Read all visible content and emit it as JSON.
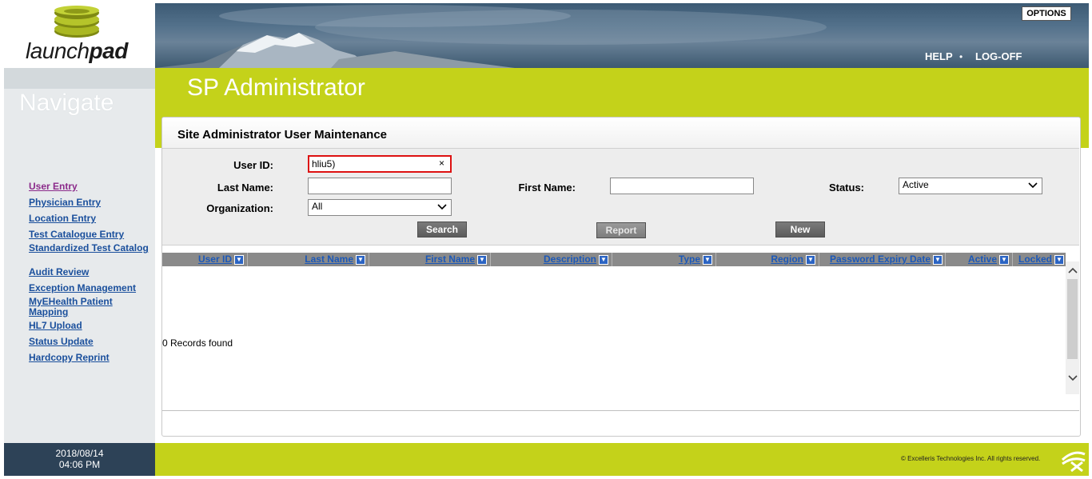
{
  "app": {
    "logo_prefix": "launch",
    "logo_suffix": "pad",
    "page_title": "SP Administrator"
  },
  "header": {
    "options": "OPTIONS",
    "help": "HELP",
    "separator": "•",
    "logoff": "LOG-OFF"
  },
  "sidebar": {
    "heading": "Navigate",
    "items": [
      {
        "label": "User Entry",
        "current": true
      },
      {
        "label": "Physician Entry"
      },
      {
        "label": "Location Entry"
      },
      {
        "label": "Test Catalogue Entry"
      },
      {
        "label": "Standardized Test Catalog"
      },
      {
        "label": "Audit Review"
      },
      {
        "label": "Exception Management"
      },
      {
        "label": "MyEHealth Patient Mapping"
      },
      {
        "label": "HL7 Upload"
      },
      {
        "label": "Status Update"
      },
      {
        "label": "Hardcopy Reprint"
      }
    ]
  },
  "panel": {
    "title": "Site Administrator User Maintenance"
  },
  "form": {
    "user_id_label": "User ID:",
    "user_id_value": "hliu5)",
    "clear_glyph": "×",
    "last_name_label": "Last Name:",
    "last_name_value": "",
    "first_name_label": "First Name:",
    "first_name_value": "",
    "status_label": "Status:",
    "status_value": "Active",
    "organization_label": "Organization:",
    "organization_value": "All",
    "search_button": "Search",
    "report_button": "Report",
    "new_button": "New"
  },
  "table": {
    "columns": [
      "User ID",
      "Last Name",
      "First Name",
      "Description",
      "Type",
      "Region",
      "Password Expiry Date",
      "Active",
      "Locked"
    ],
    "rows": [],
    "records_text": "0 Records found"
  },
  "footer": {
    "date": "2018/08/14",
    "time": "04:06 PM",
    "copyright": "© Excelleris Technologies Inc. All rights reserved."
  },
  "colors": {
    "accent": "#c4d21a",
    "header_dark": "#2d4257",
    "link": "#1a4f9c",
    "highlight_border": "#dd1111"
  },
  "icons": {
    "logo": "stacked-coins-logo-icon",
    "footer_logo": "excelleris-logo-icon"
  }
}
